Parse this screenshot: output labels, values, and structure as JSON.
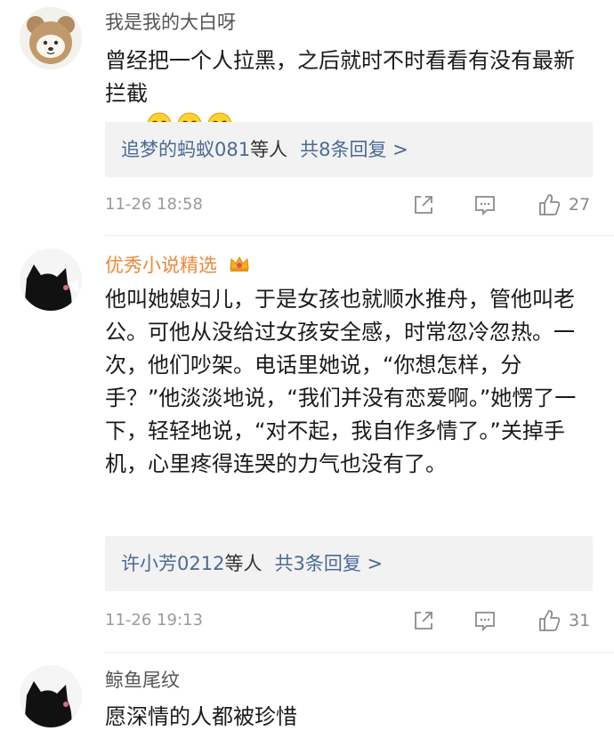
{
  "comments": [
    {
      "username": "我是我的大白呀",
      "avatar_icon": "bear-mask-avatar-icon",
      "text": "曾经把一个人拉黑，之后就时不时看看有没有最新拦截",
      "emojis": [
        "laugh-cry-emoji-icon",
        "laugh-cry-emoji-icon",
        "laugh-cry-emoji-icon"
      ],
      "reply_names": "追梦的蚂蚁081",
      "reply_who": "等人",
      "reply_total": "共8条回复 >",
      "timestamp": "11-26 18:58",
      "likes": "27"
    },
    {
      "username": "优秀小说精选",
      "avatar_icon": "black-cat-avatar-icon",
      "badge_icon": "crown-badge-icon",
      "text": "他叫她媳妇儿，于是女孩也就顺水推舟，管他叫老公。可他从没给过女孩安全感，时常忽冷忽热。一次，他们吵架。电话里她说，“你想怎样，分手？”他淡淡地说，“我们并没有恋爱啊。”她愣了一下，轻轻地说，“对不起，我自作多情了。”关掉手机，心里疼得连哭的力气也没有了。",
      "reply_names": "许小芳0212",
      "reply_who": "等人",
      "reply_total": "共3条回复 >",
      "timestamp": "11-26 19:13",
      "likes": "31"
    },
    {
      "username": "鲸鱼尾纹",
      "avatar_icon": "black-cat-avatar-icon",
      "text": "愿深情的人都被珍惜"
    }
  ],
  "action_icons": [
    "share-icon",
    "comment-icon",
    "like-icon"
  ]
}
